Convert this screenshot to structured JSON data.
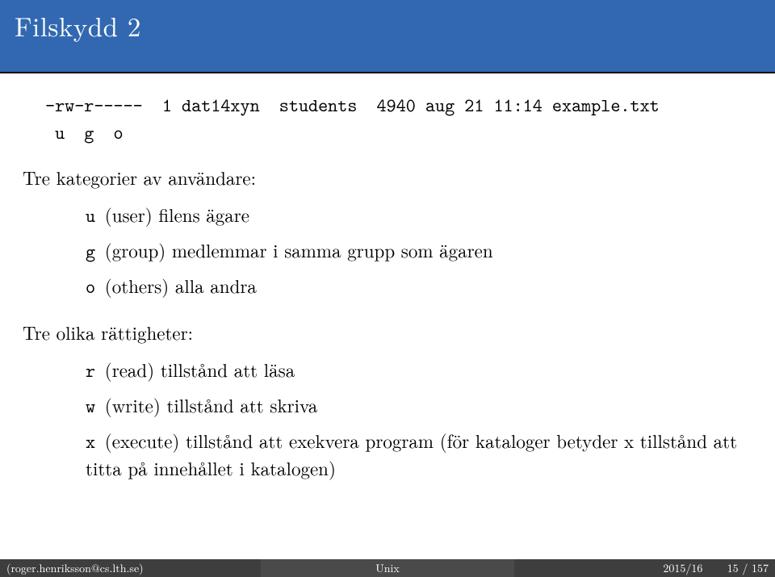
{
  "title": "Filskydd 2",
  "listing": {
    "line1": "-rw-r-----  1 dat14xyn  students  4940 aug 21 11:14 example.txt",
    "line2": " u  g  o"
  },
  "body": {
    "categories_heading": "Tre kategorier av användare:",
    "categories": [
      {
        "key": "u",
        "desc": "(user) filens ägare"
      },
      {
        "key": "g",
        "desc": "(group) medlemmar i samma grupp som ägaren"
      },
      {
        "key": "o",
        "desc": "(others) alla andra"
      }
    ],
    "rights_heading": "Tre olika rättigheter:",
    "rights": [
      {
        "key": "r",
        "desc": "(read) tillstånd att läsa"
      },
      {
        "key": "w",
        "desc": "(write) tillstånd att skriva"
      },
      {
        "key": "x",
        "desc": "(execute) tillstånd att exekvera program (för kataloger betyder x tillstånd att titta på innehållet i katalogen)"
      }
    ]
  },
  "footer": {
    "left": "(roger.henriksson@cs.lth.se)",
    "mid": "Unix",
    "right_year": "2015/16",
    "right_page": "15 / 157"
  }
}
